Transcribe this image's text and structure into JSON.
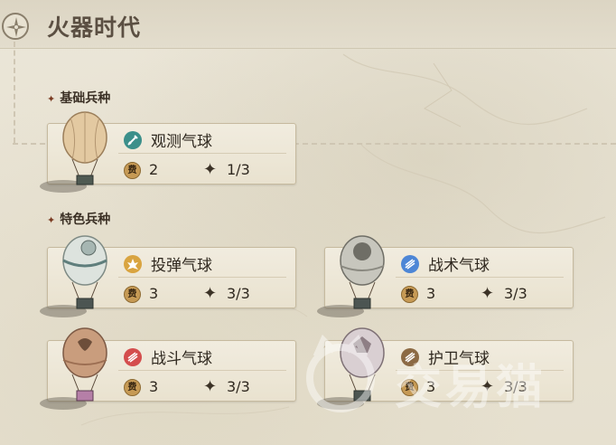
{
  "header": {
    "title": "火器时代"
  },
  "sections": [
    {
      "label": "基础兵种"
    },
    {
      "label": "特色兵种"
    }
  ],
  "units": [
    {
      "name": "观测气球",
      "cost": "2",
      "limit": "1/3",
      "type_color": "#3b8f8a",
      "type_icon": "sword-icon",
      "cost_glyph": "费"
    },
    {
      "name": "投弹气球",
      "cost": "3",
      "limit": "3/3",
      "type_color": "#d9a440",
      "type_icon": "explosion-icon",
      "cost_glyph": "费"
    },
    {
      "name": "战术气球",
      "cost": "3",
      "limit": "3/3",
      "type_color": "#4d86d6",
      "type_icon": "wing-icon",
      "cost_glyph": "费"
    },
    {
      "name": "战斗气球",
      "cost": "3",
      "limit": "3/3",
      "type_color": "#d44d4d",
      "type_icon": "wing-icon",
      "cost_glyph": "费"
    },
    {
      "name": "护卫气球",
      "cost": "3",
      "limit": "3/3",
      "type_color": "#8c6a44",
      "type_icon": "wing-icon",
      "cost_glyph": "费"
    }
  ],
  "watermark": {
    "text": "交易猫"
  },
  "colors": {
    "accent": "#7a3b22",
    "card_border": "#c6ba9f",
    "background": "#e9e4d5"
  }
}
